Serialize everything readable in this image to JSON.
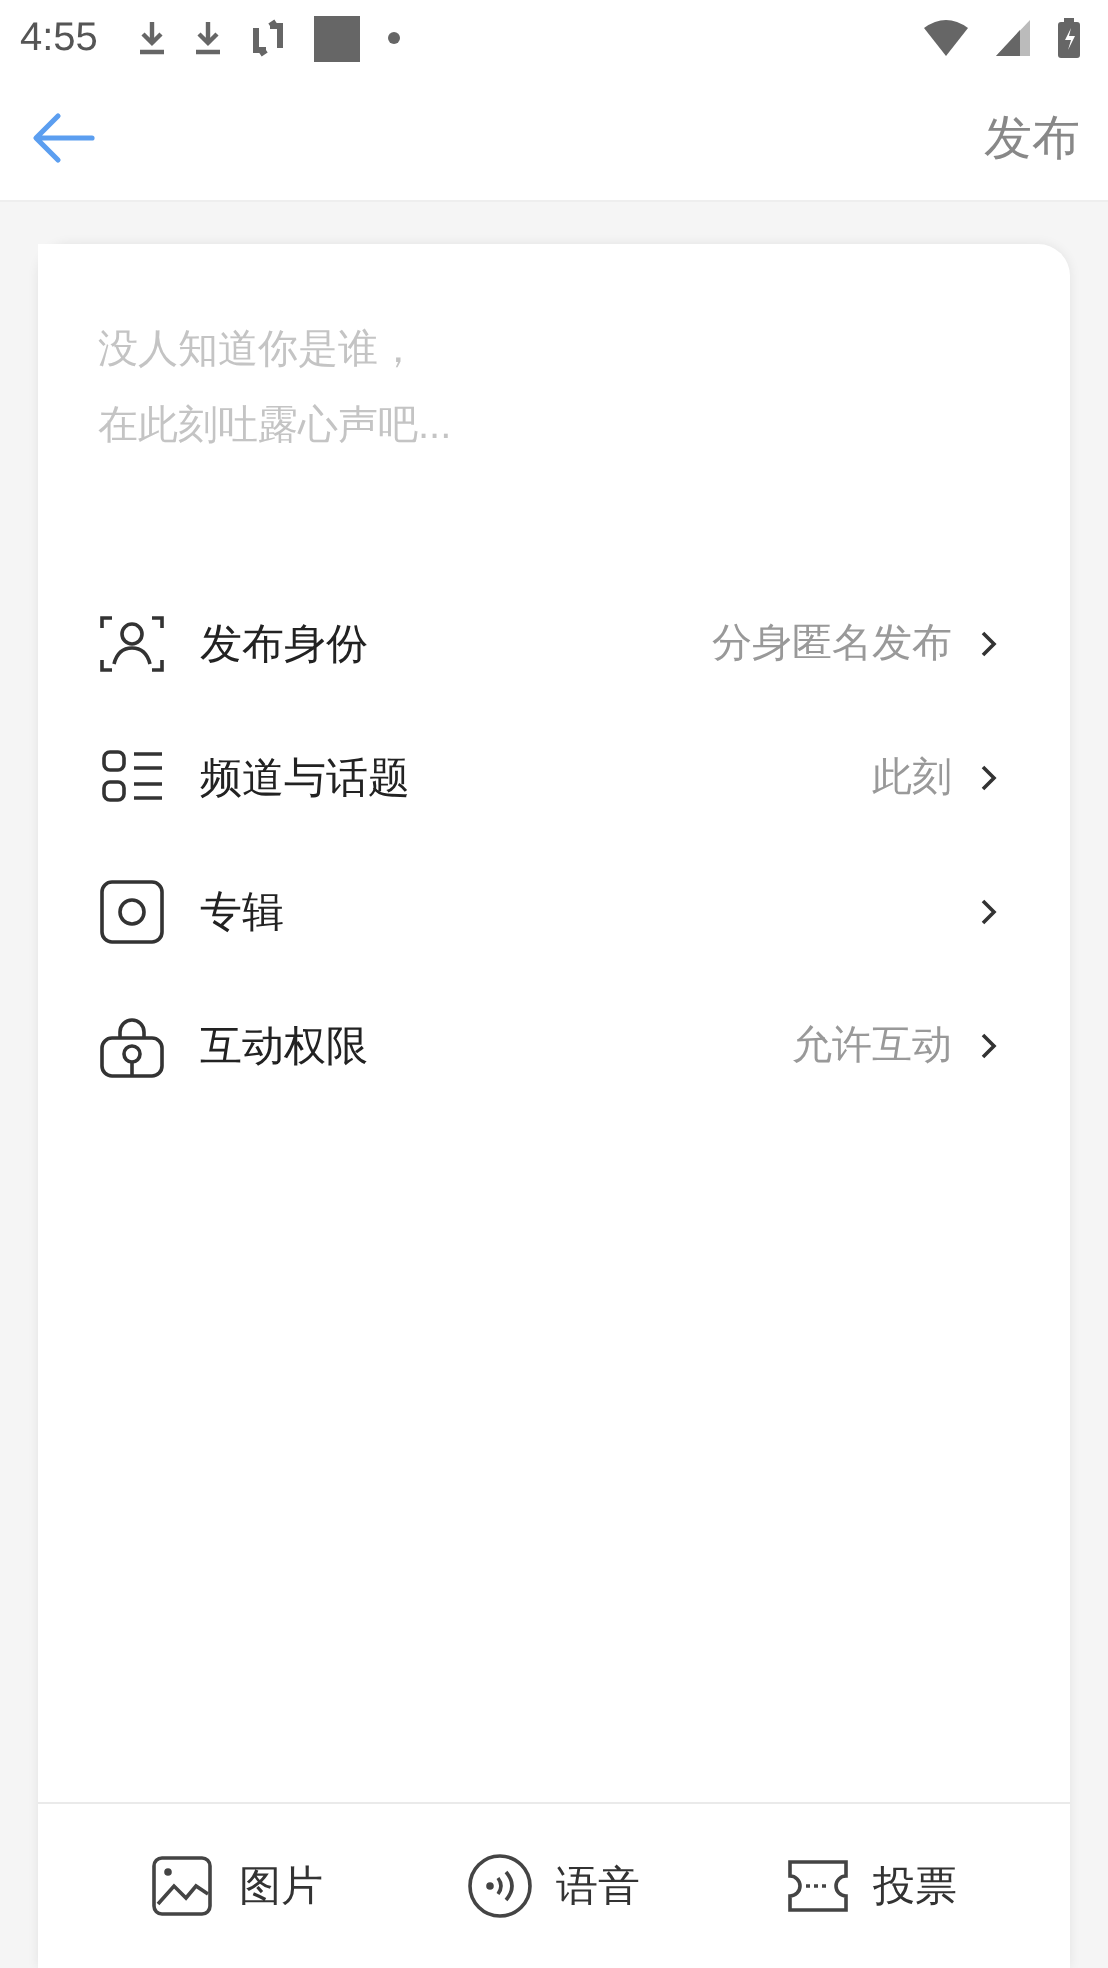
{
  "status_bar": {
    "time": "4:55"
  },
  "header": {
    "publish_button": "发布"
  },
  "composer": {
    "placeholder": "没人知道你是谁，在此刻吐露心声吧..."
  },
  "settings": [
    {
      "label": "发布身份",
      "value": "分身匿名发布"
    },
    {
      "label": "频道与话题",
      "value": "此刻"
    },
    {
      "label": "专辑"
    },
    {
      "label": "互动权限",
      "value": "允许互动"
    }
  ],
  "toolbar": [
    {
      "label": "图片"
    },
    {
      "label": "语音"
    },
    {
      "label": "投票"
    }
  ]
}
